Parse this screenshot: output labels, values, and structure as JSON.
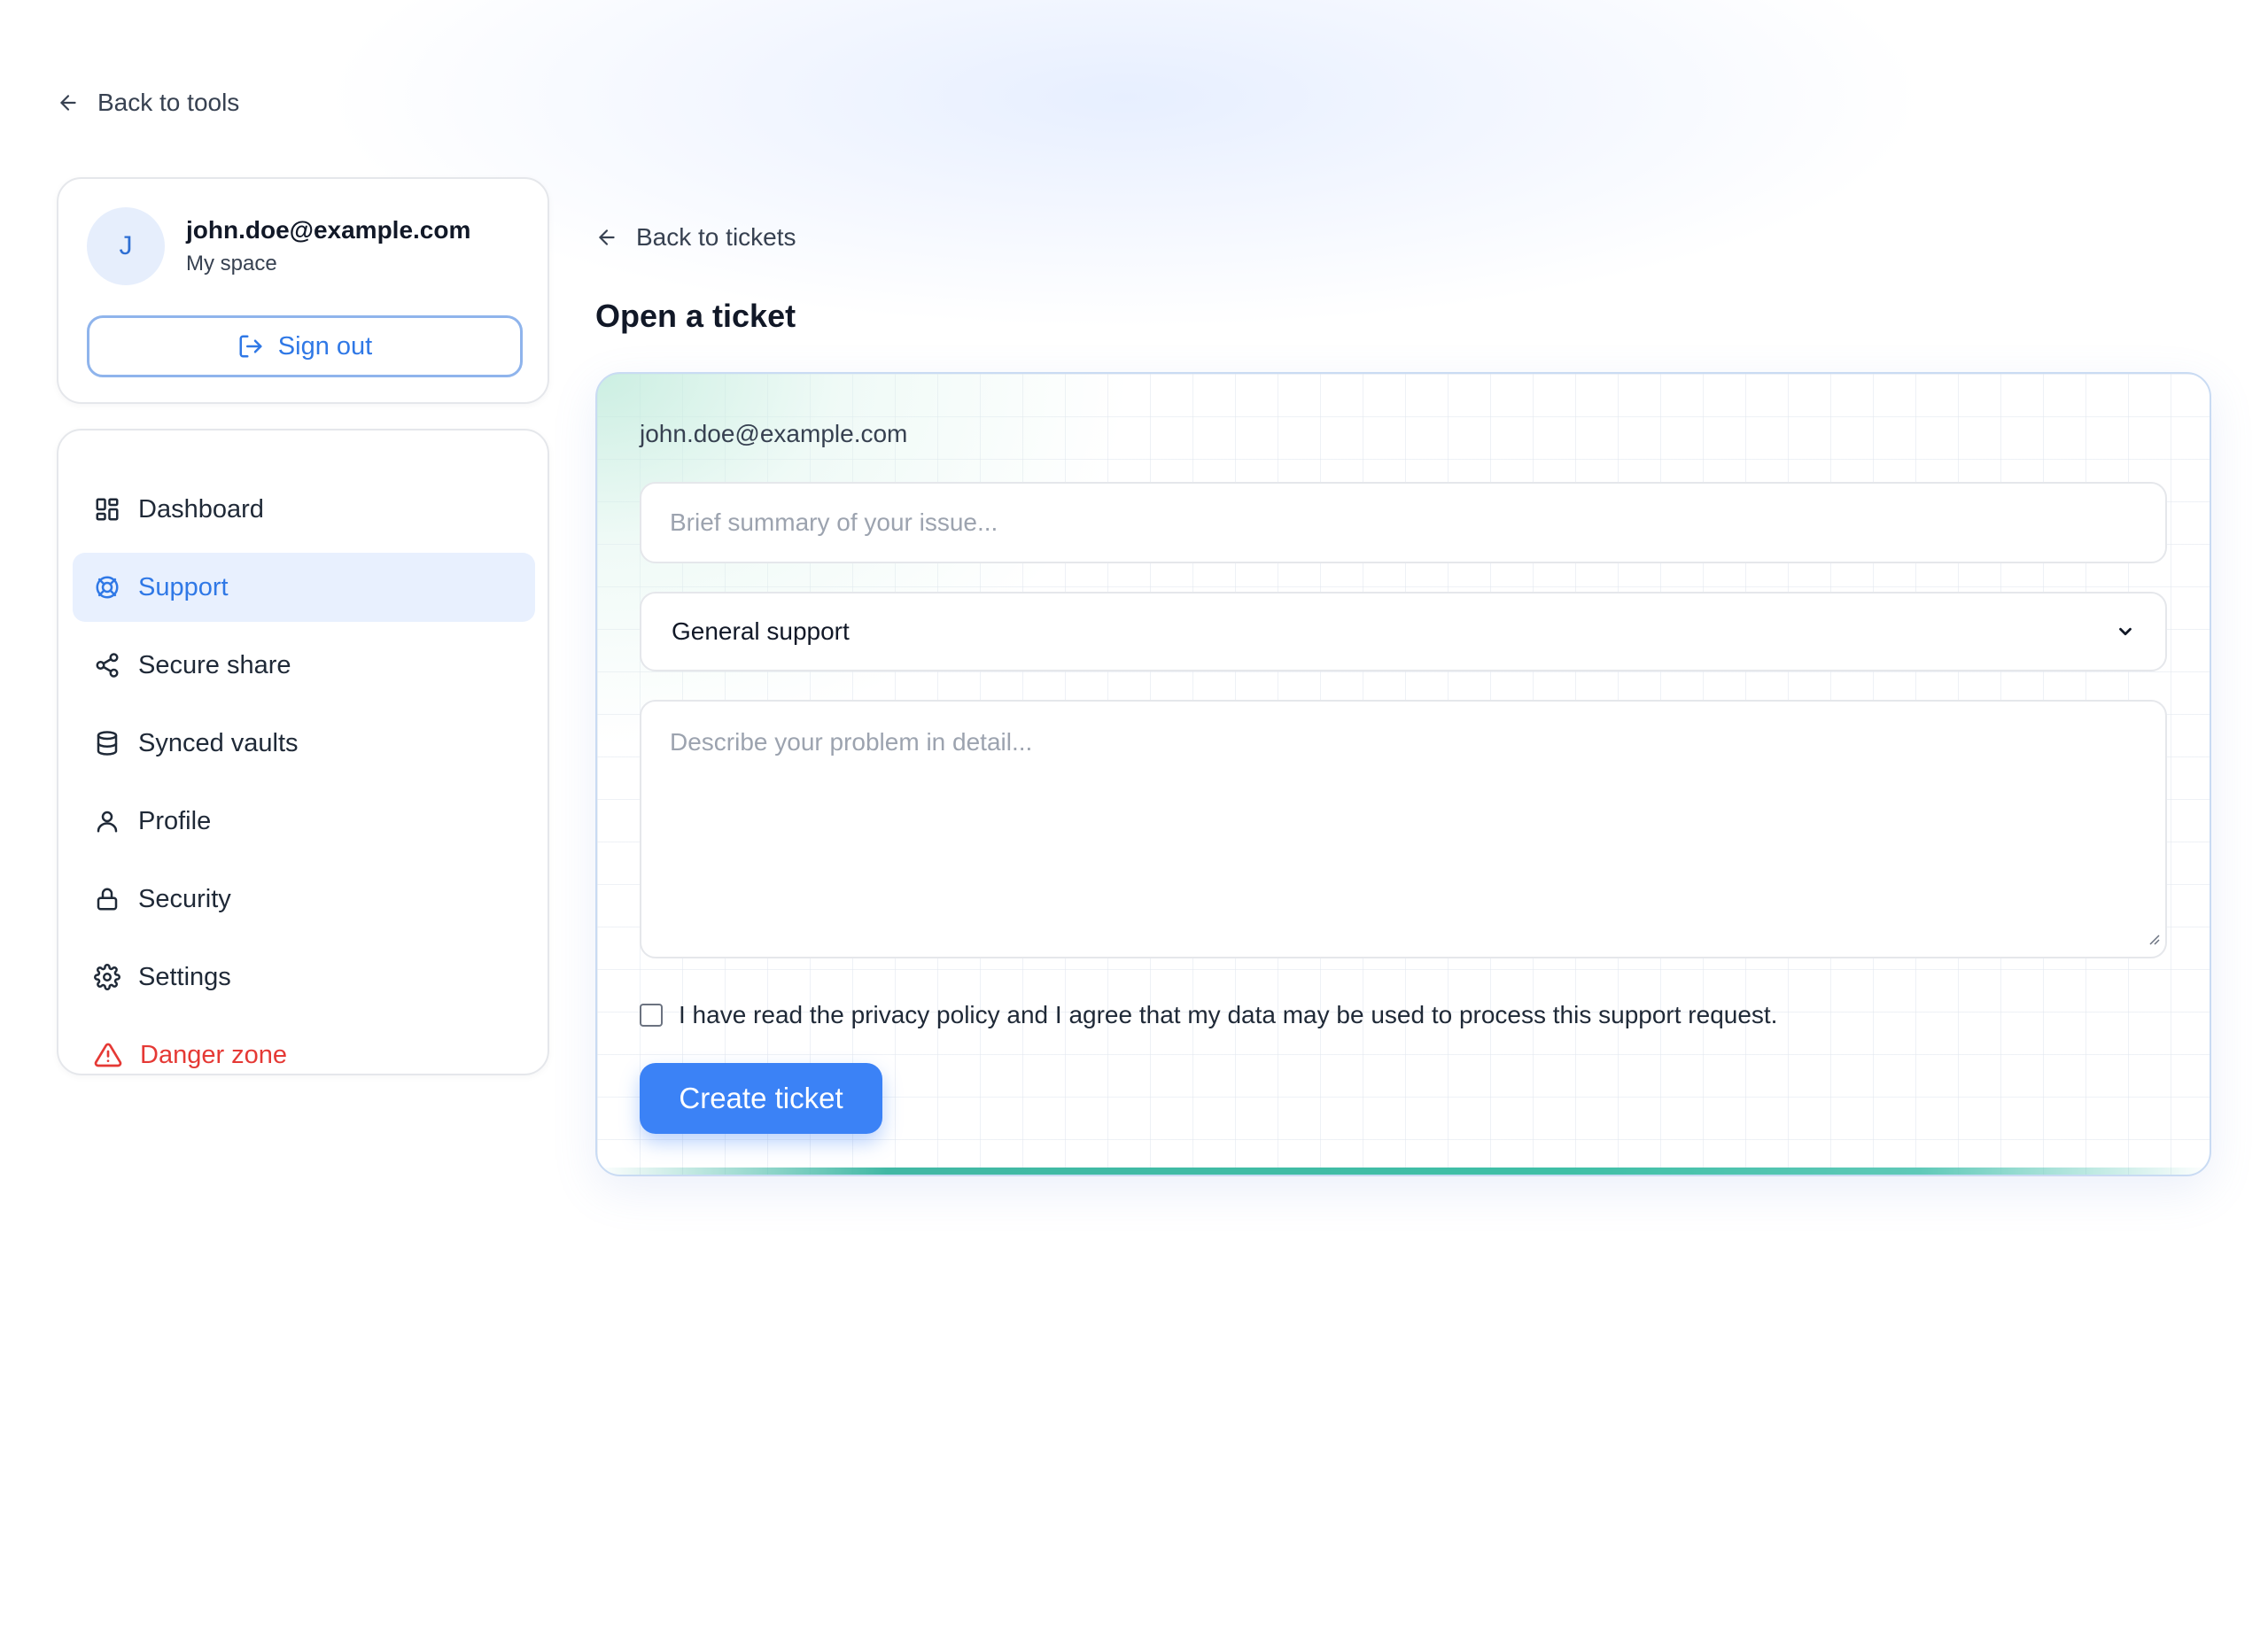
{
  "nav_top": {
    "back_to_tools": "Back to tools"
  },
  "user": {
    "avatar_initial": "J",
    "email": "john.doe@example.com",
    "space": "My space",
    "sign_out_label": "Sign out"
  },
  "sidebar": {
    "items": [
      {
        "label": "Dashboard",
        "icon": "dashboard-icon"
      },
      {
        "label": "Support",
        "icon": "lifebuoy-icon",
        "active": true
      },
      {
        "label": "Secure share",
        "icon": "share-icon"
      },
      {
        "label": "Synced vaults",
        "icon": "database-icon"
      },
      {
        "label": "Profile",
        "icon": "user-icon"
      },
      {
        "label": "Security",
        "icon": "lock-icon"
      },
      {
        "label": "Settings",
        "icon": "gear-icon"
      },
      {
        "label": "Danger zone",
        "icon": "warning-icon",
        "danger": true
      }
    ]
  },
  "main": {
    "back_to_tickets": "Back to tickets",
    "title": "Open a ticket",
    "form": {
      "email": "john.doe@example.com",
      "summary_placeholder": "Brief summary of your issue...",
      "category_selected": "General support",
      "details_placeholder": "Describe your problem in detail...",
      "consent_label": "I have read the privacy policy and I agree that my data may be used to process this support request.",
      "consent_checked": false,
      "submit_label": "Create ticket"
    }
  },
  "colors": {
    "accent": "#3b82f6",
    "active_bg": "#e8f0fe",
    "danger": "#e53935",
    "teal": "#41b8a4"
  }
}
